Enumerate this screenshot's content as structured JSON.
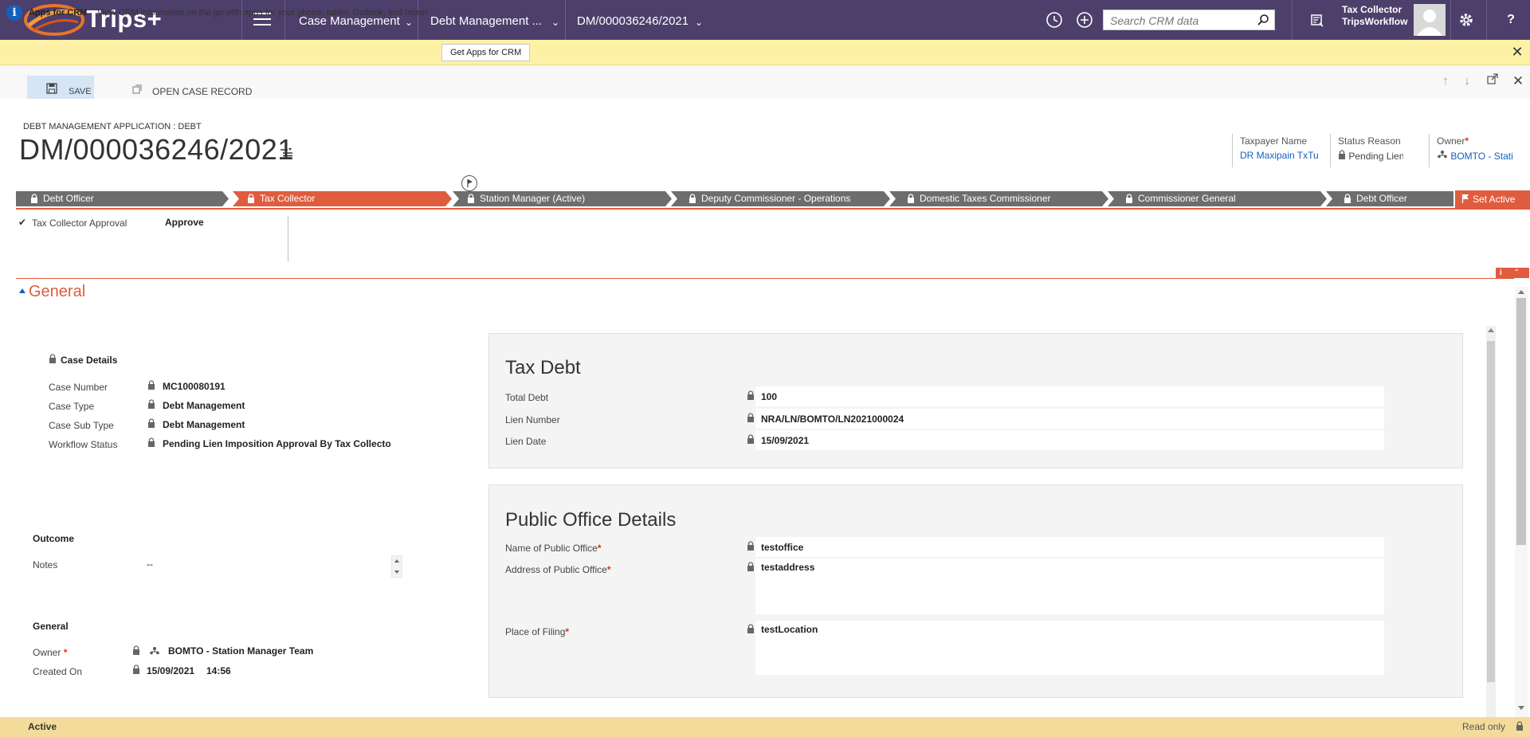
{
  "app": {
    "name": "Trips+",
    "nav": {
      "area": "Case Management",
      "entity": "Debt Management ...",
      "record": "DM/000036246/2021"
    },
    "search_placeholder": "Search CRM data",
    "user": {
      "role": "Tax Collector",
      "org": "TripsWorkflow"
    }
  },
  "notification": {
    "title": "Apps for CRM",
    "text": "View CRM information on the go with apps for your phone, tablet, Outlook, and more!",
    "button": "Get Apps for CRM"
  },
  "commands": {
    "save": "SAVE",
    "open_case": "OPEN CASE RECORD"
  },
  "header": {
    "entity_label": "DEBT MANAGEMENT APPLICATION : DEBT",
    "title": "DM/000036246/2021",
    "fields": [
      {
        "label": "Taxpayer Name",
        "value": "DR Maxipain TxTu"
      },
      {
        "label": "Status Reason",
        "value": "Pending Lien"
      },
      {
        "label": "Owner",
        "value": "BOMTO - Stati"
      }
    ]
  },
  "process": {
    "stages": [
      "Debt Officer",
      "Tax Collector",
      "Station Manager (Active)",
      "Deputy Commissioner - Operations",
      "Domestic Taxes Commissioner",
      "Commissioner General",
      "Debt Officer"
    ],
    "active_stage_index": 1,
    "set_active": "Set Active",
    "step": {
      "label": "Tax Collector Approval",
      "value": "Approve"
    }
  },
  "section": {
    "title": "General"
  },
  "case_details": {
    "title": "Case Details",
    "fields": [
      {
        "label": "Case Number",
        "value": "MC100080191"
      },
      {
        "label": "Case Type",
        "value": "Debt Management"
      },
      {
        "label": "Case Sub Type",
        "value": "Debt Management"
      },
      {
        "label": "Workflow Status",
        "value": "Pending Lien Imposition Approval By Tax Collecto"
      }
    ]
  },
  "outcome": {
    "title": "Outcome",
    "notes_label": "Notes",
    "notes_value": "--"
  },
  "general": {
    "title": "General",
    "owner_label": "Owner",
    "owner_value": "BOMTO - Station Manager Team",
    "created_label": "Created On",
    "created_date": "15/09/2021",
    "created_time": "14:56"
  },
  "tax_debt": {
    "title": "Tax Debt",
    "fields": [
      {
        "label": "Total Debt",
        "value": "100"
      },
      {
        "label": "Lien Number",
        "value": "NRA/LN/BOMTO/LN2021000024"
      },
      {
        "label": "Lien Date",
        "value": "15/09/2021"
      }
    ]
  },
  "public_office": {
    "title": "Public Office Details",
    "fields": [
      {
        "label": "Name of Public Office",
        "value": "testoffice"
      },
      {
        "label": "Address of Public Office",
        "value": "testaddress"
      },
      {
        "label": "Place of Filing",
        "value": "testLocation"
      }
    ]
  },
  "footer": {
    "status": "Active",
    "mode": "Read only"
  },
  "colors": {
    "brand_nav": "#4c3f6b",
    "accent": "#e05c3e",
    "link": "#1560bd",
    "notification": "#fdf1a6",
    "footer": "#f3dc9b"
  }
}
